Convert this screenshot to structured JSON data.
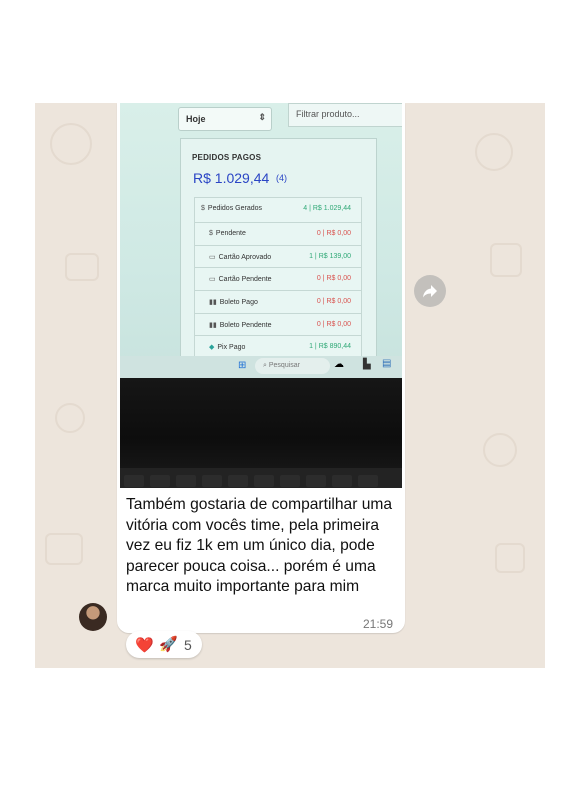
{
  "photo": {
    "period_select": "Hoje",
    "filter_placeholder": "Filtrar produto...",
    "card_title": "PEDIDOS PAGOS",
    "card_total": "R$ 1.029,44",
    "card_count": "(4)",
    "rows": [
      {
        "label": "Pedidos Gerados",
        "icon": "$",
        "value": "4 | R$ 1.029,44",
        "status": "green"
      },
      {
        "label": "Pendente",
        "icon": "$",
        "value": "0 | R$ 0,00",
        "status": "red"
      },
      {
        "label": "Cartão Aprovado",
        "icon": "▭",
        "value": "1 | R$ 139,00",
        "status": "green"
      },
      {
        "label": "Cartão Pendente",
        "icon": "▭",
        "value": "0 | R$ 0,00",
        "status": "red"
      },
      {
        "label": "Boleto Pago",
        "icon": "▮▮",
        "value": "0 | R$ 0,00",
        "status": "green"
      },
      {
        "label": "Boleto Pendente",
        "icon": "▮▮",
        "value": "0 | R$ 0,00",
        "status": "red"
      },
      {
        "label": "Pix Pago",
        "icon": "◆",
        "value": "1 | R$ 890,44",
        "status": "green"
      }
    ],
    "taskbar_search": "Pesquisar"
  },
  "message": {
    "text": "Também gostaria de compartilhar uma vitória com vocês time, pela primeira vez eu fiz 1k em um único dia, pode parecer pouca coisa... porém é uma marca muito importante para mim",
    "time": "21:59"
  },
  "reactions": {
    "emoji_1": "❤️",
    "emoji_2": "🚀",
    "count": "5"
  },
  "colors": {
    "chat_background": "#ede5dc",
    "bubble": "#ffffff",
    "total_blue": "#2a45c5",
    "status_red": "#d9534f",
    "status_green": "#2fa876"
  },
  "icons": [
    "share-forward-icon",
    "windows-start-icon",
    "search-icon",
    "heart-icon",
    "rocket-icon"
  ]
}
